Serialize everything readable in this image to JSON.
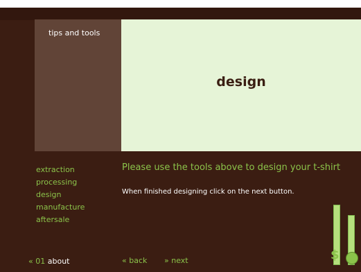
{
  "tips": {
    "title": "tips and tools"
  },
  "canvas": {
    "title": "design"
  },
  "steps": [
    "extraction",
    "processing",
    "design",
    "manufacture",
    "aftersale"
  ],
  "instructions": {
    "title": "Please use the tools above to design your t-shirt",
    "subtitle": "When finished designing click on the next button."
  },
  "footer": {
    "left_prefix": "« 01",
    "left_label": "about",
    "back": "« back",
    "next": "» next"
  },
  "icons": {
    "dollar": "$"
  },
  "colors": {
    "background": "#3b1d12",
    "accent": "#8bc34a",
    "panel": "#614437",
    "canvas": "#e6f4d7"
  }
}
